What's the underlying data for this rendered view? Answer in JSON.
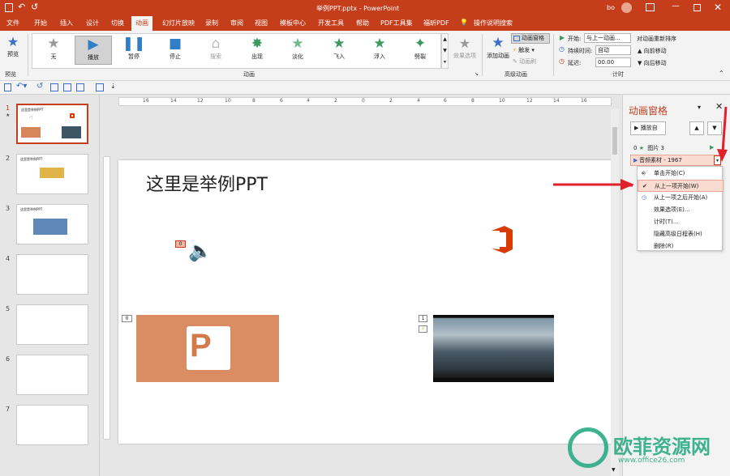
{
  "title": {
    "text": "举例PPT.pptx  -  PowerPoint",
    "user": "bo"
  },
  "menu": [
    "文件",
    "开始",
    "插入",
    "设计",
    "切换",
    "动画",
    "幻灯片放映",
    "录制",
    "审阅",
    "视图",
    "模板中心",
    "开发工具",
    "帮助",
    "PDF工具集",
    "福昕PDF",
    "操作说明搜索"
  ],
  "ribbon": {
    "preview": "预览",
    "effects": [
      "无",
      "播放",
      "暂停",
      "停止",
      "搜索",
      "出现",
      "淡化",
      "飞入",
      "浮入",
      "劈裂"
    ],
    "effect_options": "效果选项",
    "add_animation": "添加动画",
    "anim_pane": "动画窗格",
    "trigger": "触发",
    "anim_painter": "动画刷",
    "start_label": "开始:",
    "start_value": "与上一动画...",
    "duration_label": "持续时间:",
    "duration_value": "自动",
    "delay_label": "延迟:",
    "delay_value": "00.00",
    "reorder": "对动画重新排序",
    "move_earlier": "向前移动",
    "move_later": "向后移动",
    "group_preview": "预览",
    "group_animation": "动画",
    "group_advanced": "高级动画",
    "group_timing": "计时"
  },
  "thumbnails": [
    {
      "num": "1",
      "title": "这里是举例PPT"
    },
    {
      "num": "2",
      "title": "这里是举例PPT"
    },
    {
      "num": "3",
      "title": "这里是举例PPT"
    },
    {
      "num": "4"
    },
    {
      "num": "5"
    },
    {
      "num": "6"
    },
    {
      "num": "7"
    }
  ],
  "ruler_labels": [
    "16",
    "14",
    "12",
    "10",
    "8",
    "6",
    "4",
    "2",
    "0",
    "2",
    "4",
    "6",
    "8",
    "10",
    "12",
    "14",
    "16"
  ],
  "slide": {
    "title": "这里是举例PPT",
    "tags": [
      "0",
      "0",
      "1"
    ]
  },
  "pane": {
    "title": "动画窗格",
    "play_from": "播放自",
    "items": [
      {
        "index": "0",
        "name": "图片 3"
      },
      {
        "index": "",
        "name": "音频素材 - 1967"
      }
    ],
    "menu": [
      "单击开始(C)",
      "从上一项开始(W)",
      "从上一项之后开始(A)",
      "效果选项(E)...",
      "计时(T)...",
      "隐藏高级日程表(H)",
      "删除(R)"
    ]
  },
  "watermark": {
    "text": "欧菲资源网",
    "url": "www.office26.com"
  },
  "colors": {
    "accent": "#c43e1c",
    "arrow": "#e0202a",
    "menu_highlight": "#fadbd2"
  }
}
